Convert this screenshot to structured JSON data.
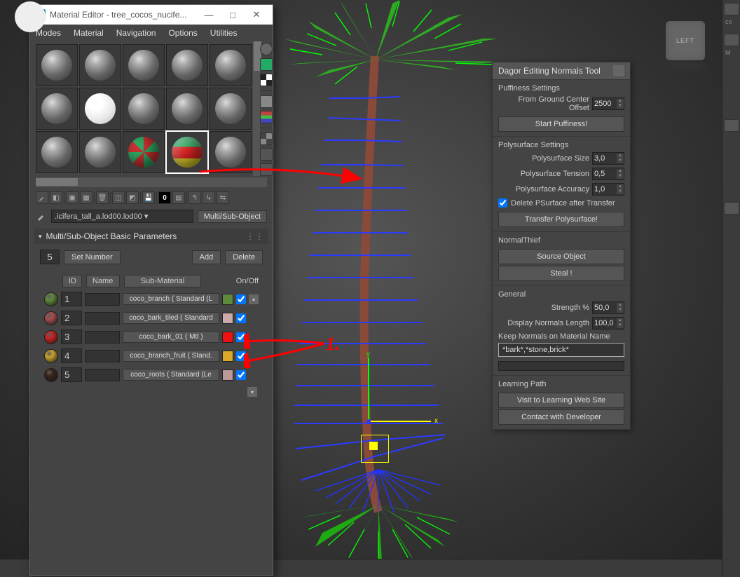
{
  "mat_editor": {
    "title": "Material Editor - tree_cocos_nucife...",
    "menus": [
      "Modes",
      "Material",
      "Navigation",
      "Options",
      "Utilities"
    ],
    "current_name": ".icifera_tall_a.lod00.lod00",
    "type_button": "Multi/Sub-Object",
    "rollout_title": "Multi/Sub-Object Basic Parameters",
    "count": "5",
    "set_number": "Set Number",
    "add": "Add",
    "delete": "Delete",
    "head_id": "ID",
    "head_name": "Name",
    "head_sub": "Sub-Material",
    "head_onoff": "On/Off",
    "rows": [
      {
        "id": "1",
        "sub": "coco_branch  ( Standard (L",
        "swatch": "#5d8a3c",
        "color": "#5d8a3c",
        "on": true,
        "up": true
      },
      {
        "id": "2",
        "sub": "coco_bark_tiled  ( Standard",
        "swatch": "#a64d4d",
        "color": "#caa",
        "on": true
      },
      {
        "id": "3",
        "sub": "coco_bark_01 ( Mtl )",
        "swatch": "#cc2222",
        "color": "#e11",
        "on": true
      },
      {
        "id": "4",
        "sub": "coco_branch_fruit  ( Stand.",
        "swatch": "#c9a12a",
        "color": "#dca82a",
        "on": true
      },
      {
        "id": "5",
        "sub": "coco_roots  ( Standard (Le",
        "swatch": "#3a2418",
        "color": "#b99",
        "on": true
      }
    ],
    "toolbar_zero": "0"
  },
  "normals": {
    "title": "Dagor Editing Normals Tool",
    "puffiness": {
      "title": "Puffiness Settings",
      "offset_label": "From Ground Center Offset",
      "offset_value": "2500",
      "start": "Start Puffiness!"
    },
    "polysurface": {
      "title": "Polysurface Settings",
      "size_label": "Polysurface Size",
      "size_value": "3,0",
      "tension_label": "Polysurface Tension",
      "tension_value": "0,5",
      "accuracy_label": "Polysurface Accuracy",
      "accuracy_value": "1,0",
      "delete_label": "Delete PSurface after Transfer",
      "transfer": "Transfer Polysurface!"
    },
    "thief": {
      "title": "NormalThief",
      "source": "Source Object",
      "steal": "Steal !"
    },
    "general": {
      "title": "General",
      "strength_label": "Strength %",
      "strength_value": "50,0",
      "length_label": "Display Normals Length",
      "length_value": "100,0",
      "keep_label": "Keep Normals on Material Name",
      "keep_value": "*bark*,*stone,brick*"
    },
    "learning": {
      "title": "Learning Path",
      "visit": "Visit to Learning Web Site",
      "contact": "Contact with Developer"
    }
  },
  "view_cube": "LEFT",
  "axis": {
    "x": "x",
    "y": "y"
  },
  "annotation": "1.",
  "right_strip_items": [
    "co",
    "M"
  ],
  "icons": {
    "chevron_down": "▾",
    "chevron_up": "▴",
    "minimize": "—",
    "maximize": "□",
    "close": "✕"
  }
}
